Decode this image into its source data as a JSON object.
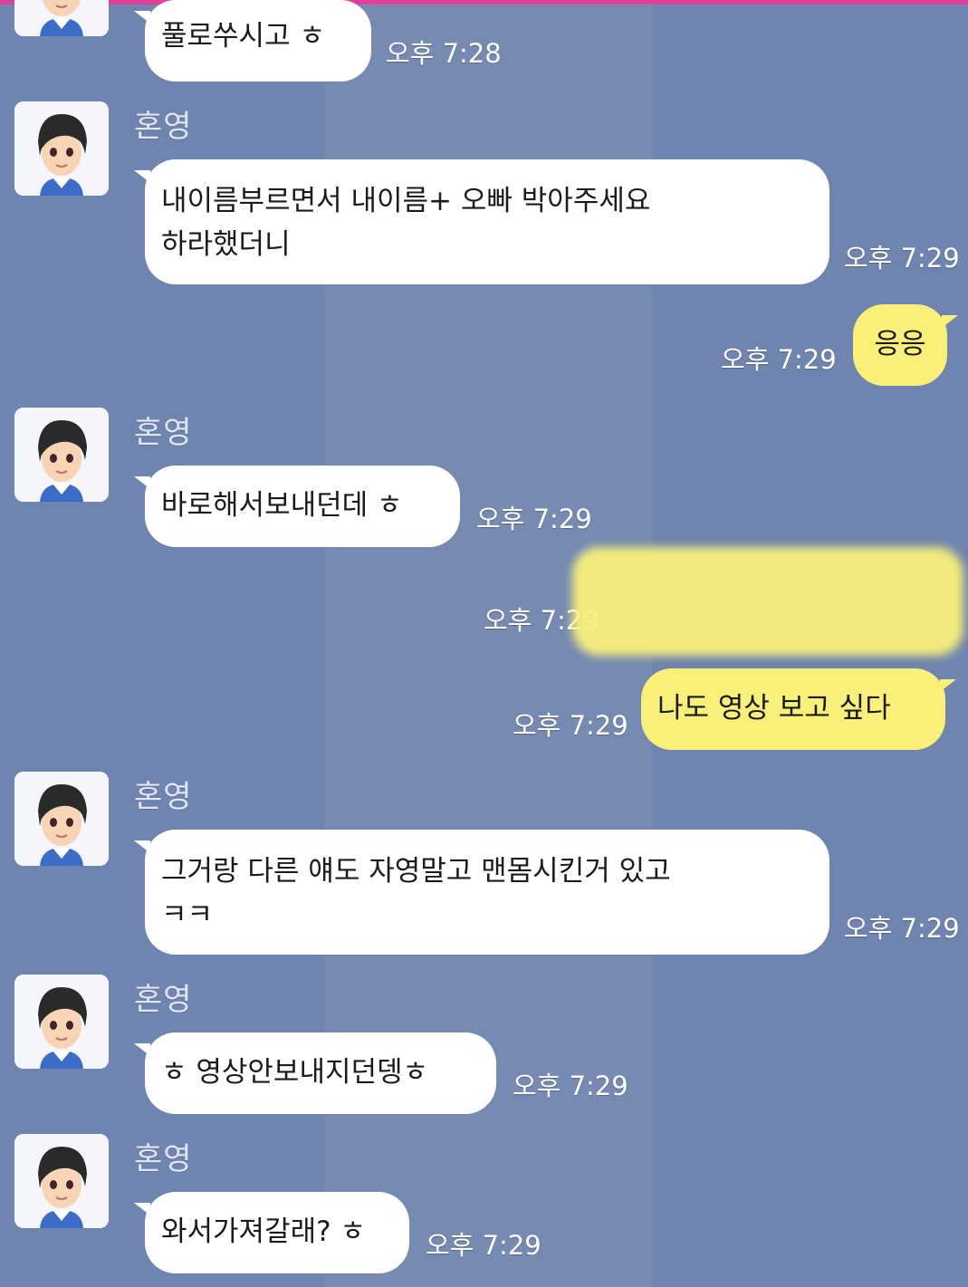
{
  "chat": {
    "sender_name": "혼영",
    "bubble_color_other": "#ffffff",
    "bubble_color_me": "#f9f07a",
    "background": "#6f84ae",
    "messages": [
      {
        "from": "other",
        "text": "풀로쑤시고 ㅎ",
        "time": "오후 7:28"
      },
      {
        "from": "other",
        "text": "내이름부르면서 내이름+ 오빠 박아주세요\n하라했더니",
        "time": "오후 7:29"
      },
      {
        "from": "me",
        "text": "응응",
        "time": "오후 7:29"
      },
      {
        "from": "other",
        "text": "바로해서보내던데 ㅎ",
        "time": "오후 7:29"
      },
      {
        "from": "me",
        "text": "",
        "time": "오후 7:29",
        "redacted": true
      },
      {
        "from": "me",
        "text": "나도 영상 보고 싶다",
        "time": "오후 7:29"
      },
      {
        "from": "other",
        "text": "그거랑 다른 얘도 자영말고 맨몸시킨거 있고\nㅋㅋ",
        "time": "오후 7:29"
      },
      {
        "from": "other",
        "text": "ㅎ 영상안보내지던뎅ㅎ",
        "time": "오후 7:29"
      },
      {
        "from": "other",
        "text": "와서가져갈래? ㅎ",
        "time": "오후 7:29"
      }
    ]
  }
}
